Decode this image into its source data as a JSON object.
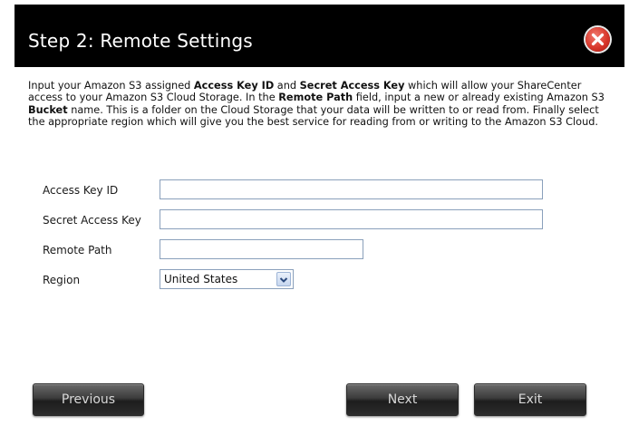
{
  "dialog": {
    "title": "Step 2: Remote Settings",
    "close_icon": "close-icon",
    "accent_red": "#d9382c"
  },
  "description": {
    "t1": "Input your Amazon S3 assigned ",
    "b1": "Access Key ID",
    "t2": " and ",
    "b2": "Secret Access Key",
    "t3": " which will allow your ShareCenter access to your Amazon S3 Cloud Storage. In the ",
    "b3": "Remote Path",
    "t4": " field, input a new or already existing Amazon S3 ",
    "b4": "Bucket",
    "t5": " name. This is a folder on the Cloud Storage that your data will be written to or read from. Finally select the appropriate region which will give you the best service for reading from or writing to the Amazon S3 Cloud."
  },
  "form": {
    "access_key_label": "Access Key ID",
    "access_key_value": "",
    "secret_key_label": "Secret Access Key",
    "secret_key_value": "",
    "remote_path_label": "Remote Path",
    "remote_path_value": "",
    "region_label": "Region",
    "region_value": "United States"
  },
  "buttons": {
    "previous": "Previous",
    "next": "Next",
    "exit": "Exit"
  }
}
